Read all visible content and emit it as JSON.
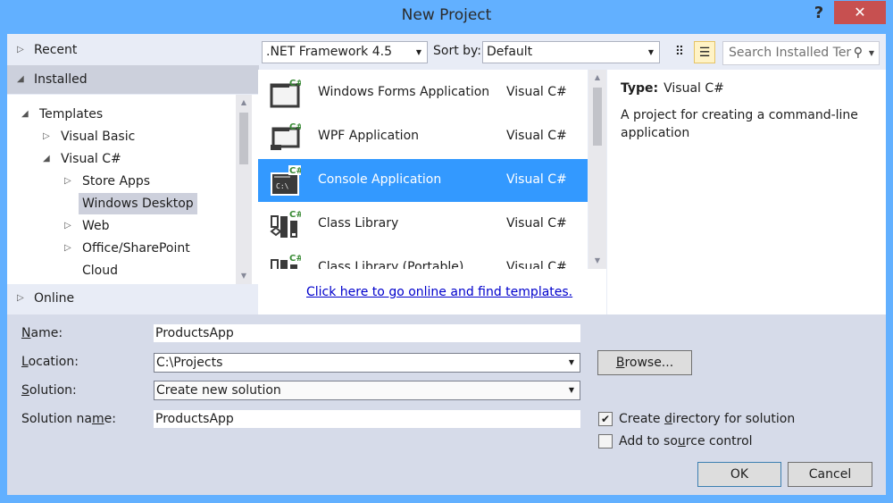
{
  "window": {
    "title": "New Project",
    "help_label": "?",
    "close_label": "✕"
  },
  "nav": {
    "recent": "Recent",
    "installed": "Installed",
    "online": "Online",
    "tree": [
      {
        "label": "Templates",
        "expanded": true
      },
      {
        "label": "Visual Basic",
        "expanded": false
      },
      {
        "label": "Visual C#",
        "expanded": true
      },
      {
        "label": "Store Apps",
        "expanded": false
      },
      {
        "label": "Windows Desktop",
        "selected": true
      },
      {
        "label": "Web",
        "expanded": false
      },
      {
        "label": "Office/SharePoint",
        "expanded": false
      },
      {
        "label": "Cloud"
      }
    ]
  },
  "toolbar": {
    "framework": ".NET Framework 4.5",
    "sort_label": "Sort by:",
    "sort_value": "Default",
    "search_placeholder": "Search Installed Ter",
    "view_small_icons": "small-icons-view",
    "view_list": "list-view"
  },
  "templates": [
    {
      "name": "Windows Forms Application",
      "lang": "Visual C#",
      "icon": "winforms-icon"
    },
    {
      "name": "WPF Application",
      "lang": "Visual C#",
      "icon": "wpf-icon"
    },
    {
      "name": "Console Application",
      "lang": "Visual C#",
      "icon": "console-icon",
      "selected": true
    },
    {
      "name": "Class Library",
      "lang": "Visual C#",
      "icon": "class-library-icon"
    },
    {
      "name": "Class Library (Portable)",
      "lang": "Visual C#",
      "icon": "portable-class-library-icon"
    }
  ],
  "online_link": "Click here to go online and find templates.",
  "info": {
    "type_label": "Type:",
    "type_value": "Visual C#",
    "description": "A project for creating a command-line application"
  },
  "form": {
    "name_label_u": "N",
    "name_label_rest": "ame:",
    "name_value": "ProductsApp",
    "location_label_u": "L",
    "location_label_rest": "ocation:",
    "location_value": "C:\\Projects",
    "solution_label_u": "S",
    "solution_label_rest": "olution:",
    "solution_value": "Create new solution",
    "solution_name_label_pre": "Solution na",
    "solution_name_label_u": "m",
    "solution_name_label_post": "e:",
    "solution_name_value": "ProductsApp",
    "browse_u": "B",
    "browse_rest": "rowse...",
    "create_dir_pre": "Create ",
    "create_dir_u": "d",
    "create_dir_post": "irectory for solution",
    "create_dir_checked": true,
    "source_control_pre": "Add to so",
    "source_control_u": "u",
    "source_control_post": "rce control",
    "source_control_checked": false,
    "ok": "OK",
    "cancel": "Cancel"
  },
  "colors": {
    "frame": "#62b0ff",
    "selection": "#3399ff",
    "close": "#c75050",
    "csharp_badge": "#388a34"
  }
}
